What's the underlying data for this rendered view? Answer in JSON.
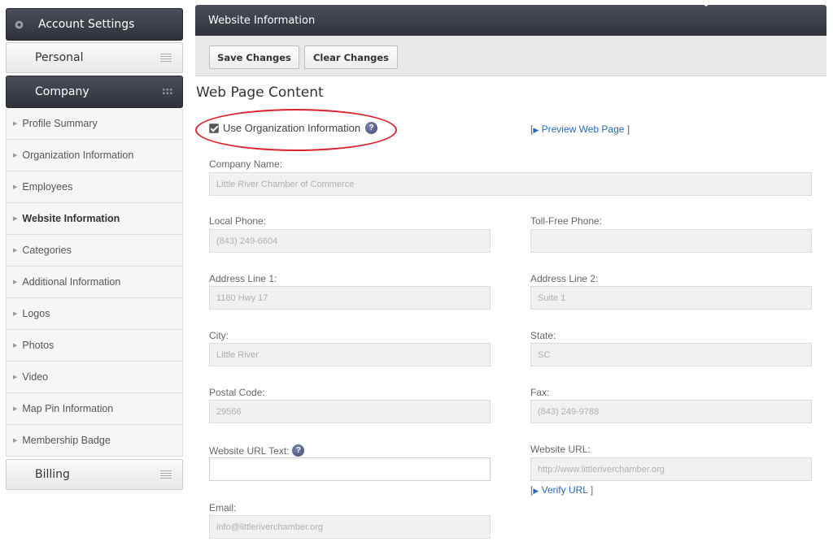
{
  "sidebar": {
    "account_settings": "Account Settings",
    "personal": "Personal",
    "company": "Company",
    "billing": "Billing",
    "items": [
      {
        "label": "Profile Summary",
        "active": false
      },
      {
        "label": "Organization Information",
        "active": false
      },
      {
        "label": "Employees",
        "active": false
      },
      {
        "label": "Website Information",
        "active": true
      },
      {
        "label": "Categories",
        "active": false
      },
      {
        "label": "Additional Information",
        "active": false
      },
      {
        "label": "Logos",
        "active": false
      },
      {
        "label": "Photos",
        "active": false
      },
      {
        "label": "Video",
        "active": false
      },
      {
        "label": "Map Pin Information",
        "active": false
      },
      {
        "label": "Membership Badge",
        "active": false
      }
    ]
  },
  "header": {
    "title": "Website Information"
  },
  "toolbar": {
    "save_label": "Save Changes",
    "clear_label": "Clear Changes"
  },
  "content": {
    "section_title": "Web Page Content",
    "use_org_info_label": "Use Organization Information",
    "use_org_info_checked": true,
    "preview_link": "Preview Web Page",
    "verify_link": "Verify URL",
    "company_name": {
      "label": "Company Name:",
      "value": "Little River Chamber of Commerce"
    },
    "local_phone": {
      "label": "Local Phone:",
      "value": "(843) 249-6604"
    },
    "toll_free_phone": {
      "label": "Toll-Free Phone:",
      "value": ""
    },
    "address_line_1": {
      "label": "Address Line 1:",
      "value": "1180 Hwy 17"
    },
    "address_line_2": {
      "label": "Address Line 2:",
      "value": "Suite 1"
    },
    "city": {
      "label": "City:",
      "value": "Little River"
    },
    "state": {
      "label": "State:",
      "value": "SC"
    },
    "postal_code": {
      "label": "Postal Code:",
      "value": "29566"
    },
    "fax": {
      "label": "Fax:",
      "value": "(843) 249-9788"
    },
    "website_url_text": {
      "label": "Website URL Text:",
      "value": ""
    },
    "website_url": {
      "label": "Website URL:",
      "value": "http://www.littleriverchamber.org"
    },
    "email": {
      "label": "Email:",
      "value": "info@littleriverchamber.org"
    }
  },
  "colors": {
    "annotation_circle": "#d8232a",
    "link": "#2a6ab0",
    "header_dark": "#3a3d45"
  },
  "icons": {
    "gear": "gear-icon",
    "help": "help-icon",
    "menu": "menu-icon",
    "grid": "grid-icon"
  }
}
